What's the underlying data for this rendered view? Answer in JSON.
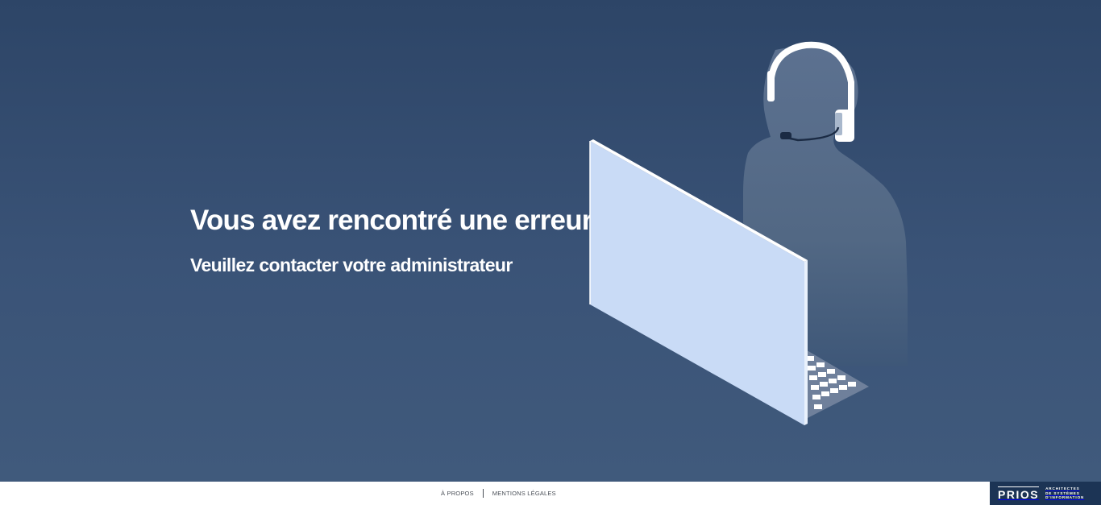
{
  "error": {
    "title": "Vous avez rencontré une erreur",
    "subtitle": "Veuillez contacter votre administrateur"
  },
  "illustration": {
    "name": "support-agent-at-computer",
    "colors": {
      "screen": "#c9dbf6",
      "screen_edge": "#ffffff",
      "person": "#556b8a",
      "headset": "#ffffff",
      "keyboard": "#ffffff"
    }
  },
  "footer": {
    "links": {
      "about": "À PROPOS",
      "legal": "MENTIONS LÉGALES"
    }
  },
  "brand": {
    "name": "PRIOS",
    "tagline": [
      "ARCHITECTES",
      "DE SYSTÈMES",
      "D'INFORMATION"
    ],
    "color": "#1c3455"
  }
}
